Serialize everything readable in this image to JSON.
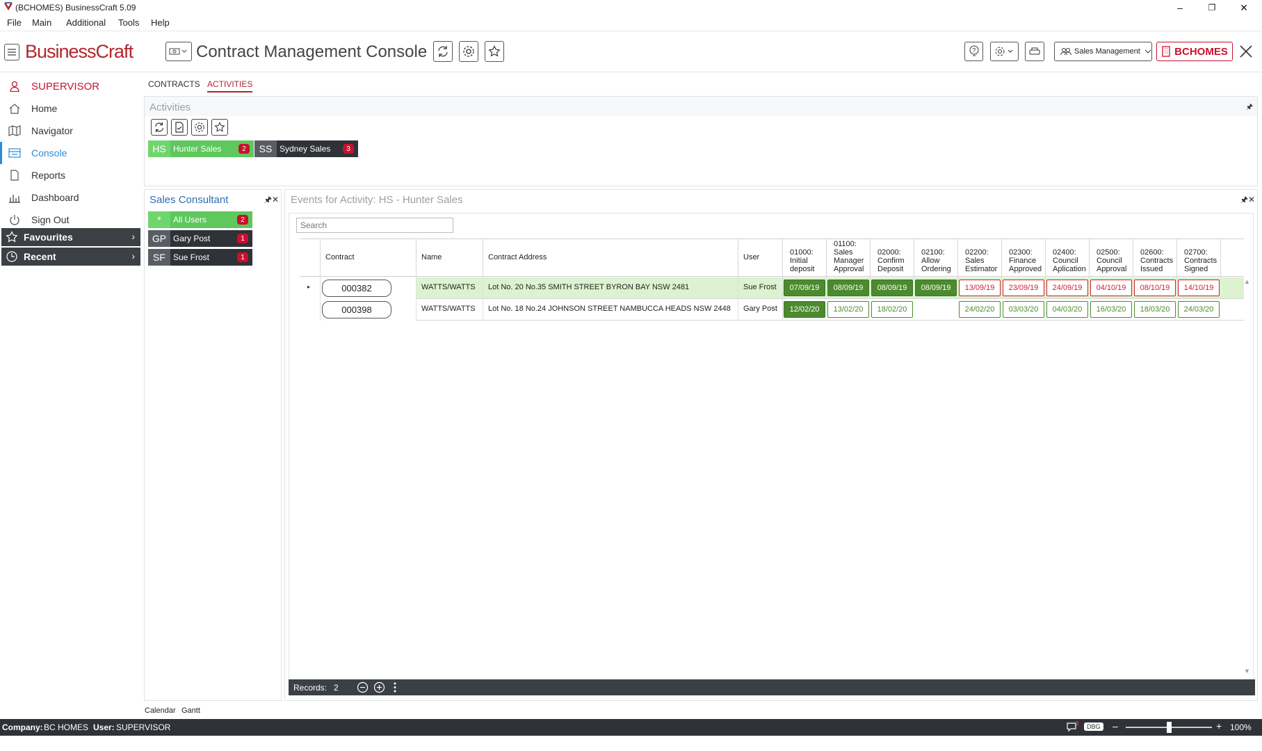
{
  "window": {
    "title": "(BCHOMES) BusinessCraft  5.09",
    "minimize": "–",
    "restore": "❐",
    "close": "✕"
  },
  "menu": [
    "File",
    "Main",
    "Additional",
    "Tools",
    "Help"
  ],
  "header": {
    "brand": "BusinessCraft",
    "title": "Contract Management Console",
    "role_select": "Sales Management",
    "company_button": "BCHOMES"
  },
  "sidebar": {
    "user": "SUPERVISOR",
    "items": [
      {
        "label": "Home",
        "icon": "home-icon"
      },
      {
        "label": "Navigator",
        "icon": "map-icon"
      },
      {
        "label": "Console",
        "icon": "console-icon"
      },
      {
        "label": "Reports",
        "icon": "document-icon"
      },
      {
        "label": "Dashboard",
        "icon": "bar-chart-icon"
      },
      {
        "label": "Sign Out",
        "icon": "power-icon"
      }
    ],
    "favourites": "Favourites",
    "recent": "Recent"
  },
  "tabs": [
    "CONTRACTS",
    "ACTIVITIES"
  ],
  "activities": {
    "title": "Activities",
    "chips": [
      {
        "abbr": "HS",
        "name": "Hunter Sales",
        "count": "2",
        "style": "green"
      },
      {
        "abbr": "SS",
        "name": "Sydney Sales",
        "count": "3",
        "style": "dark"
      }
    ]
  },
  "consultants": {
    "title": "Sales Consultant",
    "chips": [
      {
        "abbr": "*",
        "name": "All Users",
        "count": "2",
        "style": "green"
      },
      {
        "abbr": "GP",
        "name": "Gary Post",
        "count": "1",
        "style": "dark"
      },
      {
        "abbr": "SF",
        "name": "Sue Frost",
        "count": "1",
        "style": "dark"
      }
    ]
  },
  "events": {
    "title": "Events for Activity: HS - Hunter Sales",
    "search_placeholder": "Search",
    "columns": {
      "contract": "Contract",
      "name": "Name",
      "address": "Contract Address",
      "user": "User",
      "events": [
        [
          "01000:",
          "Initial",
          "deposit"
        ],
        [
          "01100:",
          "Sales",
          "Manager",
          "Approval"
        ],
        [
          "02000:",
          "Confirm",
          "Deposit"
        ],
        [
          "02100:",
          "Allow",
          "Ordering"
        ],
        [
          "02200:",
          "Sales",
          "Estimator"
        ],
        [
          "02300:",
          "Finance",
          "Approved"
        ],
        [
          "02400:",
          "Council",
          "Aplication"
        ],
        [
          "02500:",
          "Council",
          "Approval"
        ],
        [
          "02600:",
          "Contracts",
          "Issued"
        ],
        [
          "02700:",
          "Contracts",
          "Signed"
        ]
      ]
    },
    "rows": [
      {
        "contract": "000382",
        "name": "WATTS/WATTS",
        "address": "Lot No. 20 No.35 SMITH STREET BYRON BAY NSW 2481",
        "user": "Sue Frost",
        "selected": true,
        "events": [
          {
            "date": "07/09/19",
            "status": "done"
          },
          {
            "date": "08/09/19",
            "status": "done"
          },
          {
            "date": "08/09/19",
            "status": "done"
          },
          {
            "date": "08/09/19",
            "status": "done"
          },
          {
            "date": "13/09/19",
            "status": "late"
          },
          {
            "date": "23/09/19",
            "status": "late"
          },
          {
            "date": "24/09/19",
            "status": "late"
          },
          {
            "date": "04/10/19",
            "status": "late"
          },
          {
            "date": "08/10/19",
            "status": "late"
          },
          {
            "date": "14/10/19",
            "status": "late"
          }
        ]
      },
      {
        "contract": "000398",
        "name": "WATTS/WATTS",
        "address": "Lot No. 18 No.24 JOHNSON STREET NAMBUCCA HEADS NSW 2448",
        "user": "Gary Post",
        "selected": false,
        "events": [
          {
            "date": "12/02/20",
            "status": "done"
          },
          {
            "date": "13/02/20",
            "status": "due"
          },
          {
            "date": "18/02/20",
            "status": "due"
          },
          {
            "date": "",
            "status": "none"
          },
          {
            "date": "24/02/20",
            "status": "due"
          },
          {
            "date": "03/03/20",
            "status": "due"
          },
          {
            "date": "04/03/20",
            "status": "due"
          },
          {
            "date": "16/03/20",
            "status": "due"
          },
          {
            "date": "18/03/20",
            "status": "due"
          },
          {
            "date": "24/03/20",
            "status": "due"
          }
        ]
      }
    ],
    "records_label": "Records:",
    "records_count": "2"
  },
  "bottom_links": [
    "Calendar",
    "Gantt"
  ],
  "status": {
    "company_label": "Company:",
    "company": "BC HOMES",
    "user_label": "User:",
    "user": "SUPERVISOR",
    "msg_count": "3",
    "dbg": "DBG",
    "zoom": "100%",
    "zoom_level": 0.5
  },
  "colors": {
    "brand": "#b1272c",
    "done": "#4c8a2f",
    "late": "#d01e2e",
    "selected_row": "#dcf2d0"
  }
}
